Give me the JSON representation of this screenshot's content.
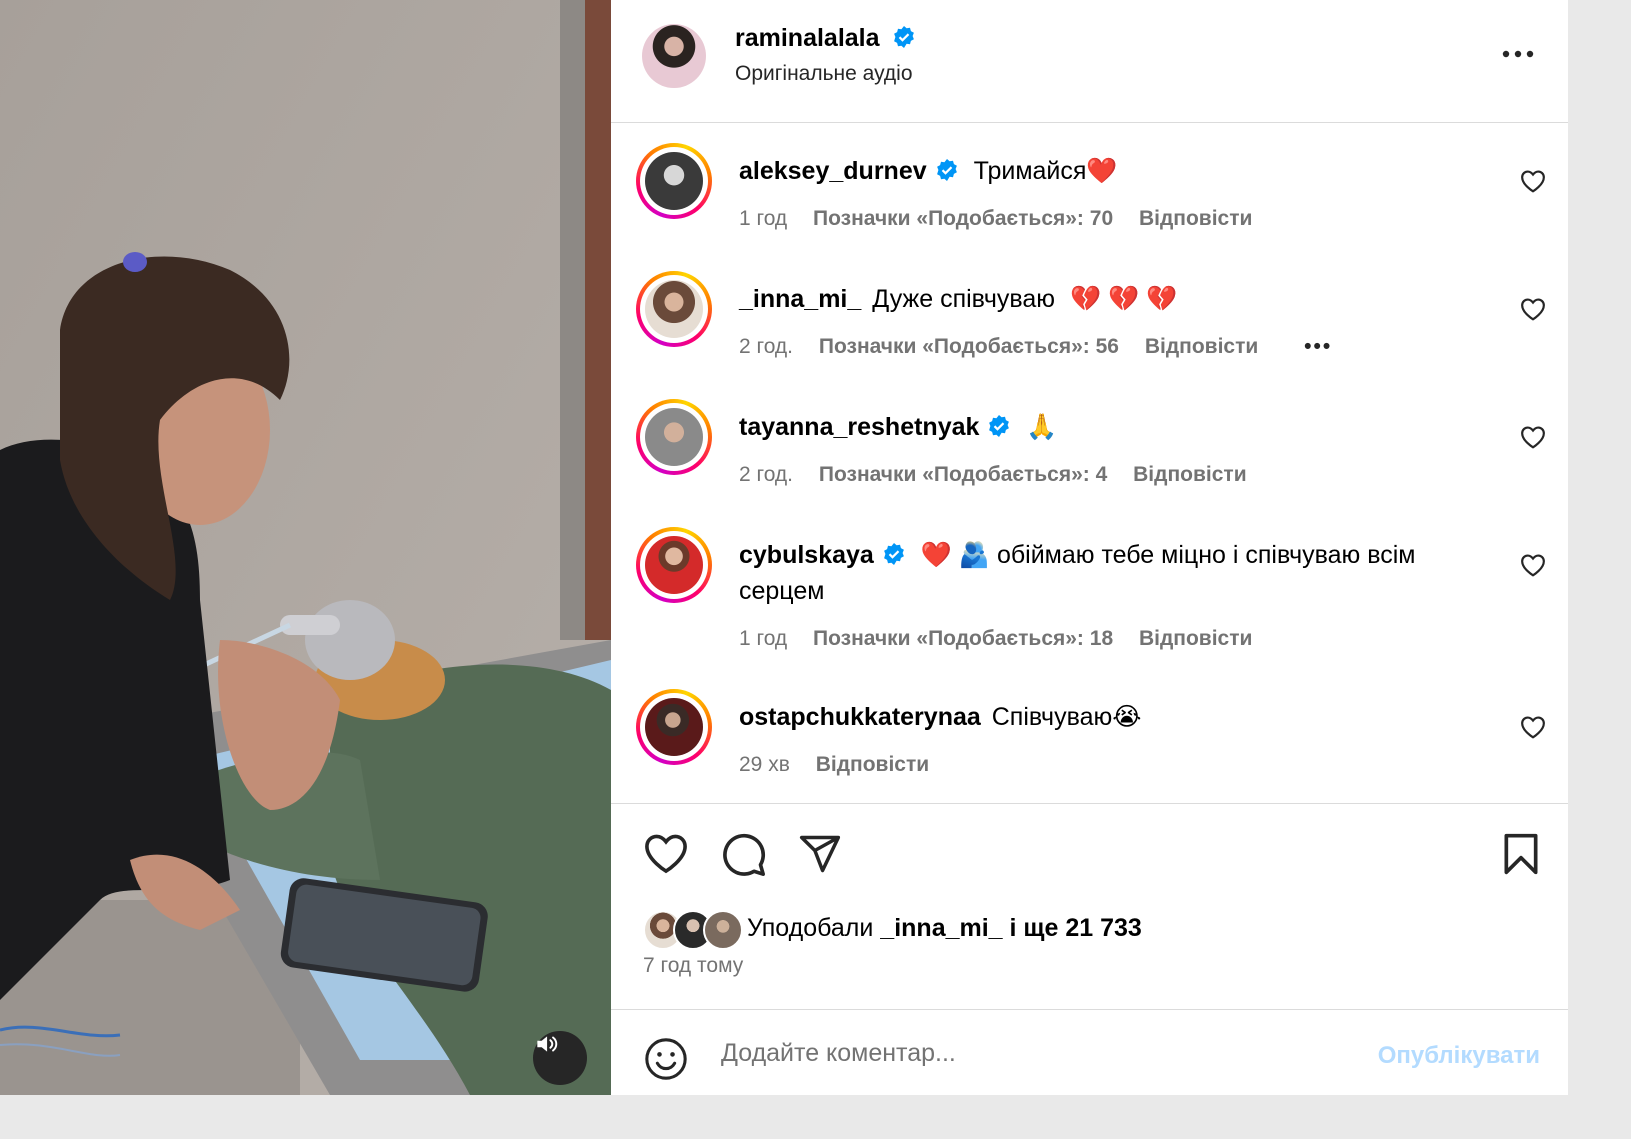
{
  "post": {
    "author": "raminalalala",
    "audio": "Оригінальне аудіо",
    "more_icon": "more-horizontal-icon",
    "verified_color": "#0095f6"
  },
  "comments": [
    {
      "user": "aleksey_durnev",
      "verified": true,
      "text": "Тримайся",
      "emoji": "❤️",
      "time": "1 год",
      "likes": "Позначки «Подобається»: 70",
      "reply": "Відповісти"
    },
    {
      "user": "_inna_mi_",
      "verified": false,
      "text": "Дуже співчуваю",
      "emoji": "💔 💔 💔",
      "time": "2 год.",
      "likes": "Позначки «Подобається»: 56",
      "reply": "Відповісти",
      "more": "•••"
    },
    {
      "user": "tayanna_reshetnyak",
      "verified": true,
      "text": "",
      "emoji": "🙏",
      "time": "2 год.",
      "likes": "Позначки «Подобається»: 4",
      "reply": "Відповісти"
    },
    {
      "user": "cybulskaya",
      "verified": true,
      "emoji": "❤️ 🫂",
      "text": "обіймаю тебе міцно і співчуваю всім серцем",
      "time": "1 год",
      "likes": "Позначки «Подобається»: 18",
      "reply": "Відповісти"
    },
    {
      "user": "ostapchukkaterynaa",
      "verified": false,
      "text": "Співчуваю",
      "emoji": "😭",
      "time": "29 хв",
      "reply": "Відповісти"
    }
  ],
  "actions": {
    "likes_prefix": "Уподобали",
    "likes_user": "_inna_mi_",
    "likes_suffix": "і ще 21 733",
    "time_ago": "7 год тому"
  },
  "composer": {
    "placeholder": "Додайте коментар...",
    "publish": "Опублікувати"
  },
  "icons": [
    "heart-icon",
    "comment-icon",
    "share-icon",
    "bookmark-icon",
    "emoji-icon",
    "volume-icon"
  ]
}
